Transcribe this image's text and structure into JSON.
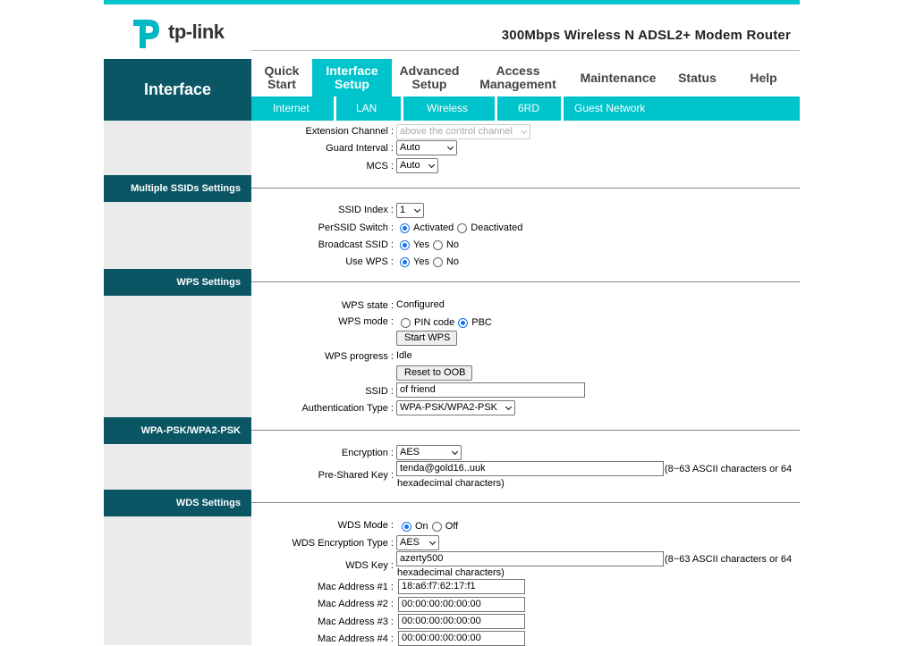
{
  "brand": {
    "logo_text": "tp-link",
    "model": "300Mbps Wireless N ADSL2+ Modem Router"
  },
  "sidebar_title": "Interface",
  "menu": [
    {
      "label": "Quick Start"
    },
    {
      "label": "Interface Setup"
    },
    {
      "label": "Advanced Setup"
    },
    {
      "label": "Access Management"
    },
    {
      "label": "Maintenance"
    },
    {
      "label": "Status"
    },
    {
      "label": "Help"
    }
  ],
  "submenu": [
    "Internet",
    "LAN",
    "Wireless",
    "6RD",
    "Guest Network"
  ],
  "wireless": {
    "extension_channel": {
      "label": "Extension Channel :",
      "value": "above the control channel"
    },
    "guard_interval": {
      "label": "Guard Interval :",
      "value": "Auto"
    },
    "mcs": {
      "label": "MCS :",
      "value": "Auto"
    }
  },
  "multiple_ssid": {
    "title": "Multiple SSIDs Settings",
    "ssid_index": {
      "label": "SSID Index :",
      "value": "1"
    },
    "perssid_switch": {
      "label": "PerSSID Switch :",
      "opt1": "Activated",
      "opt2": "Deactivated",
      "selected": "Activated"
    },
    "broadcast_ssid": {
      "label": "Broadcast SSID :",
      "opt1": "Yes",
      "opt2": "No",
      "selected": "Yes"
    },
    "use_wps": {
      "label": "Use WPS :",
      "opt1": "Yes",
      "opt2": "No",
      "selected": "Yes"
    }
  },
  "wps": {
    "title": "WPS Settings",
    "state": {
      "label": "WPS state :",
      "value": "Configured"
    },
    "mode": {
      "label": "WPS mode :",
      "opt1": "PIN code",
      "opt2": "PBC",
      "selected": "PBC"
    },
    "start_button": "Start WPS",
    "progress": {
      "label": "WPS progress :",
      "value": "Idle"
    },
    "reset_button": "Reset to OOB",
    "ssid": {
      "label": "SSID :",
      "value": "of friend"
    },
    "auth": {
      "label": "Authentication Type :",
      "value": "WPA-PSK/WPA2-PSK"
    }
  },
  "wpa": {
    "title": "WPA-PSK/WPA2-PSK",
    "encryption": {
      "label": "Encryption :",
      "value": "AES"
    },
    "psk": {
      "label": "Pre-Shared Key :",
      "value": "tenda@gold16..uuk",
      "hint1": "(8~63 ASCII characters or 64",
      "hint2": "hexadecimal characters)"
    }
  },
  "wds": {
    "title": "WDS Settings",
    "mode": {
      "label": "WDS Mode :",
      "opt1": "On",
      "opt2": "Off",
      "selected": "On"
    },
    "enc_type": {
      "label": "WDS Encryption Type :",
      "value": "AES"
    },
    "key": {
      "label": "WDS Key :",
      "value": "azerty500",
      "hint1": "(8~63 ASCII characters or 64",
      "hint2": "hexadecimal characters)"
    },
    "mac1": {
      "label": "Mac Address #1 :",
      "value": "18:a6:f7:62:17:f1"
    },
    "mac2": {
      "label": "Mac Address #2 :",
      "value": "00:00:00:00:00:00"
    },
    "mac3": {
      "label": "Mac Address #3 :",
      "value": "00:00:00:00:00:00"
    },
    "mac4": {
      "label": "Mac Address #4 :",
      "value": "00:00:00:00:00:00"
    }
  },
  "colors": {
    "accent": "#00c4cc",
    "dark_teal": "#0b5665",
    "radio_blue": "#1a73e8"
  }
}
